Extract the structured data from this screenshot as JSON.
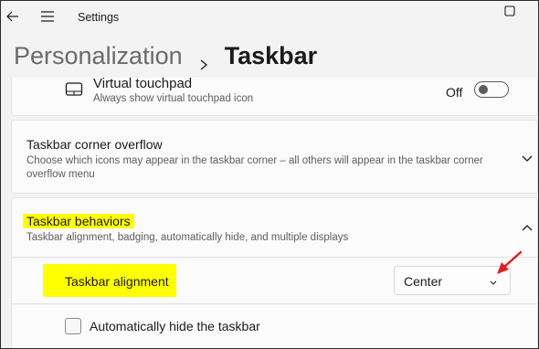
{
  "window": {
    "app_title": "Settings"
  },
  "header": {
    "parent": "Personalization",
    "current": "Taskbar"
  },
  "touchpad_row": {
    "title": "Virtual touchpad",
    "desc": "Always show virtual touchpad icon",
    "toggle_label": "Off",
    "toggle_on": false
  },
  "overflow_card": {
    "title": "Taskbar corner overflow",
    "desc_line1": "Choose which icons may appear in the taskbar corner – all others will appear in the taskbar corner",
    "desc_line2": "overflow menu"
  },
  "behaviors_card": {
    "title": "Taskbar behaviors",
    "desc": "Taskbar alignment, badging, automatically hide, and multiple displays",
    "alignment_label": "Taskbar alignment",
    "alignment_value": "Center",
    "autohide_label": "Automatically hide the taskbar",
    "autohide_checked": false
  },
  "colors": {
    "highlight": "#ffff00",
    "annotation_arrow": "#e02020"
  },
  "icons": [
    "back-arrow-icon",
    "hamburger-menu-icon",
    "maximize-icon",
    "chevron-right-icon",
    "touchpad-icon",
    "chevron-down-icon",
    "chevron-up-icon",
    "red-arrow-annotation"
  ]
}
